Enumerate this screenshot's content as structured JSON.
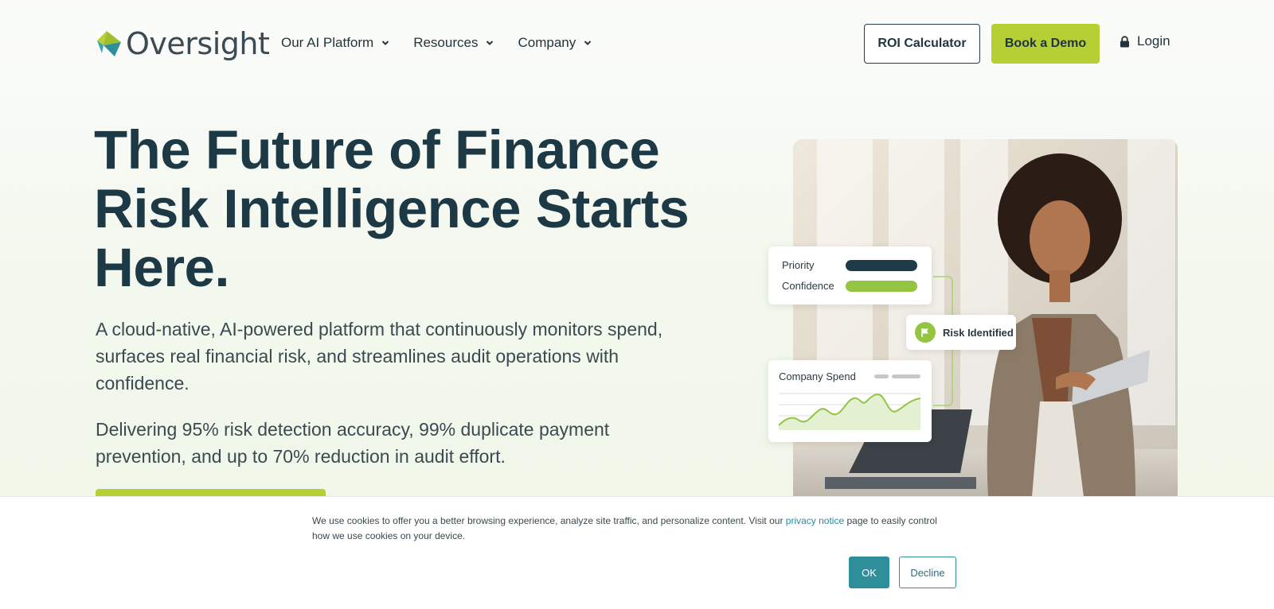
{
  "header": {
    "logo_text": "Oversight",
    "nav": [
      {
        "label": "Our AI Platform"
      },
      {
        "label": "Resources"
      },
      {
        "label": "Company"
      }
    ],
    "roi_label": "ROI Calculator",
    "demo_label": "Book a Demo",
    "login_label": "Login"
  },
  "hero": {
    "headline": "The Future of Finance Risk Intelligence Starts Here.",
    "subtitle": "A cloud-native, AI-powered platform that continuously monitors spend, surfaces real financial risk, and streamlines audit operations with confidence.",
    "stats": "Delivering 95% risk detection accuracy, 99% duplicate payment prevention, and up to 70% reduction in audit effort."
  },
  "overlay_cards": {
    "priority_label": "Priority",
    "confidence_label": "Confidence",
    "risk_label": "Risk Identified",
    "spend_title": "Company Spend"
  },
  "cookie": {
    "text_before": "We use cookies to offer you a better browsing experience, analyze site traffic, and personalize content. Visit our ",
    "link_text": "privacy notice",
    "text_after": " page to easily control how we use cookies on your device.",
    "ok_label": "OK",
    "decline_label": "Decline"
  },
  "colors": {
    "brand_green": "#b6cf35",
    "navy": "#1c3945",
    "teal": "#2e8f9a",
    "priority_bar": "#1f3a48",
    "confidence_bar": "#93c542"
  }
}
